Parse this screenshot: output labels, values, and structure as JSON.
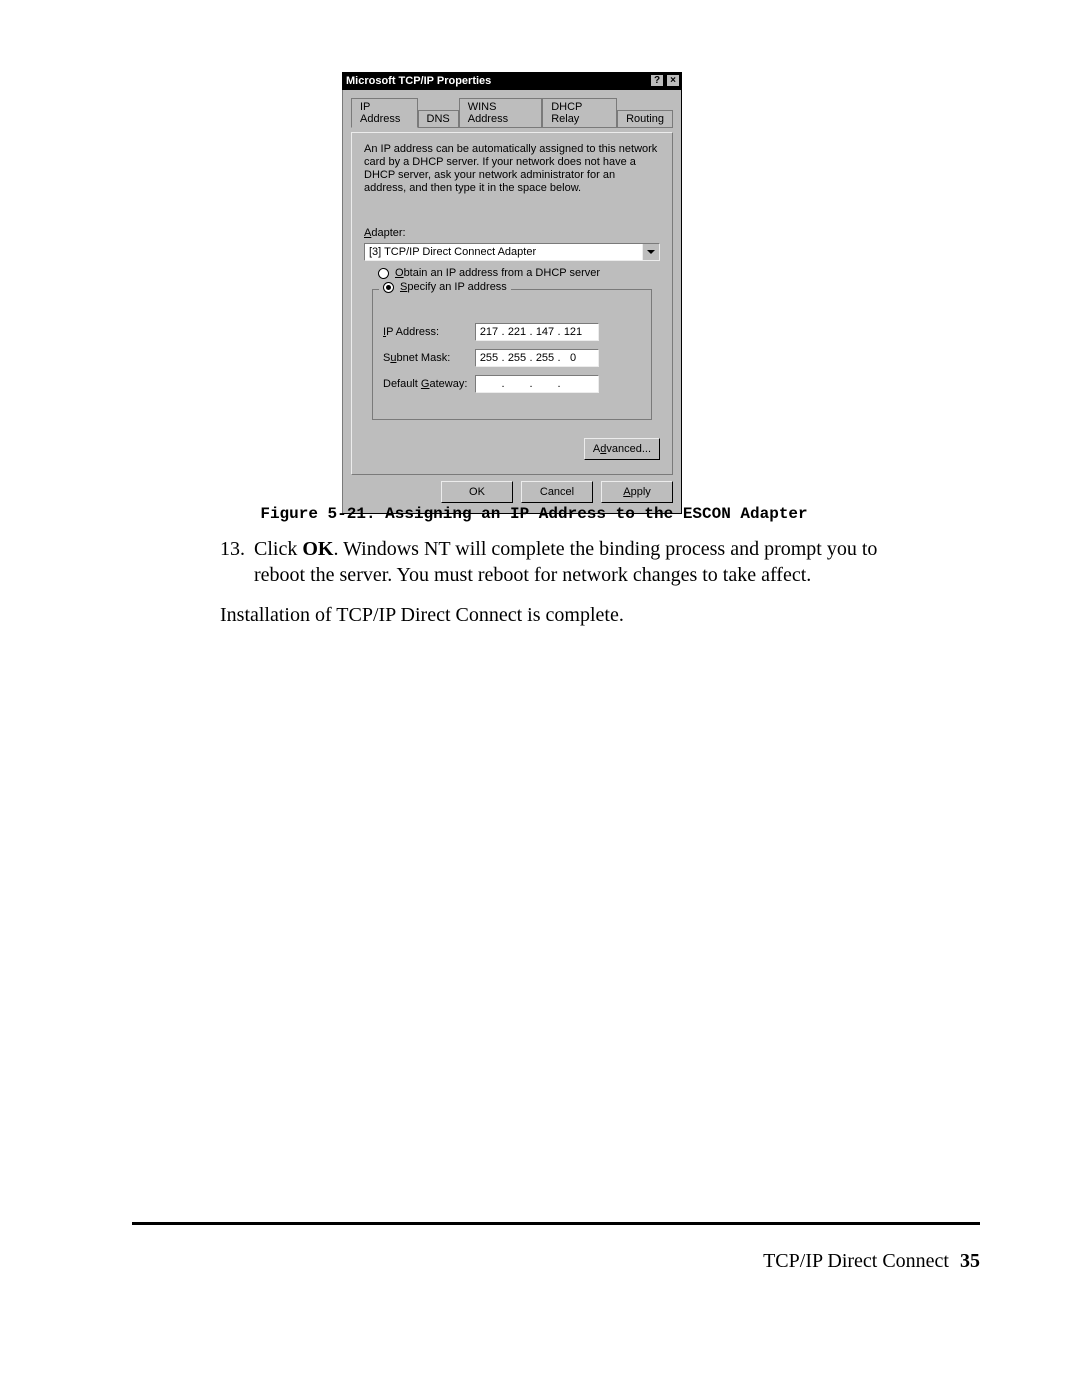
{
  "dialog": {
    "title": "Microsoft TCP/IP Properties",
    "help_symbol": "?",
    "close_symbol": "×",
    "tabs": [
      "IP Address",
      "DNS",
      "WINS Address",
      "DHCP Relay",
      "Routing"
    ],
    "active_tab_index": 0,
    "explanation": "An IP address can be automatically assigned to this network card by a DHCP server.  If your network does not have a DHCP server, ask your network administrator for an address, and then type it in the space below.",
    "adapter_label": "Adapter:",
    "adapter_value": "[3] TCP/IP Direct Connect Adapter",
    "radio_obtain": "Obtain an IP address from a DHCP server",
    "radio_specify": "Specify an IP address",
    "selected_radio": "specify",
    "fields": {
      "ip_label": "IP Address:",
      "subnet_label": "Subnet Mask:",
      "gateway_label": "Default Gateway:",
      "ip": [
        "217",
        "221",
        "147",
        "121"
      ],
      "subnet": [
        "255",
        "255",
        "255",
        "0"
      ],
      "gateway": [
        "",
        "",
        "",
        ""
      ]
    },
    "advanced_label": "Advanced...",
    "ok_label": "OK",
    "cancel_label": "Cancel",
    "apply_label": "Apply"
  },
  "caption": "Figure 5-21.  Assigning an IP Address to the ESCON Adapter",
  "step": {
    "number": "13.",
    "lead": "Click ",
    "bold": "OK",
    "tail1": ".  Windows NT will complete the binding process and prompt you to",
    "tail2": "reboot the server.  You must reboot for network changes to take affect."
  },
  "install_line": "Installation of TCP/IP Direct Connect is complete.",
  "footer": {
    "text": "TCP/IP Direct Connect",
    "page": "35"
  }
}
